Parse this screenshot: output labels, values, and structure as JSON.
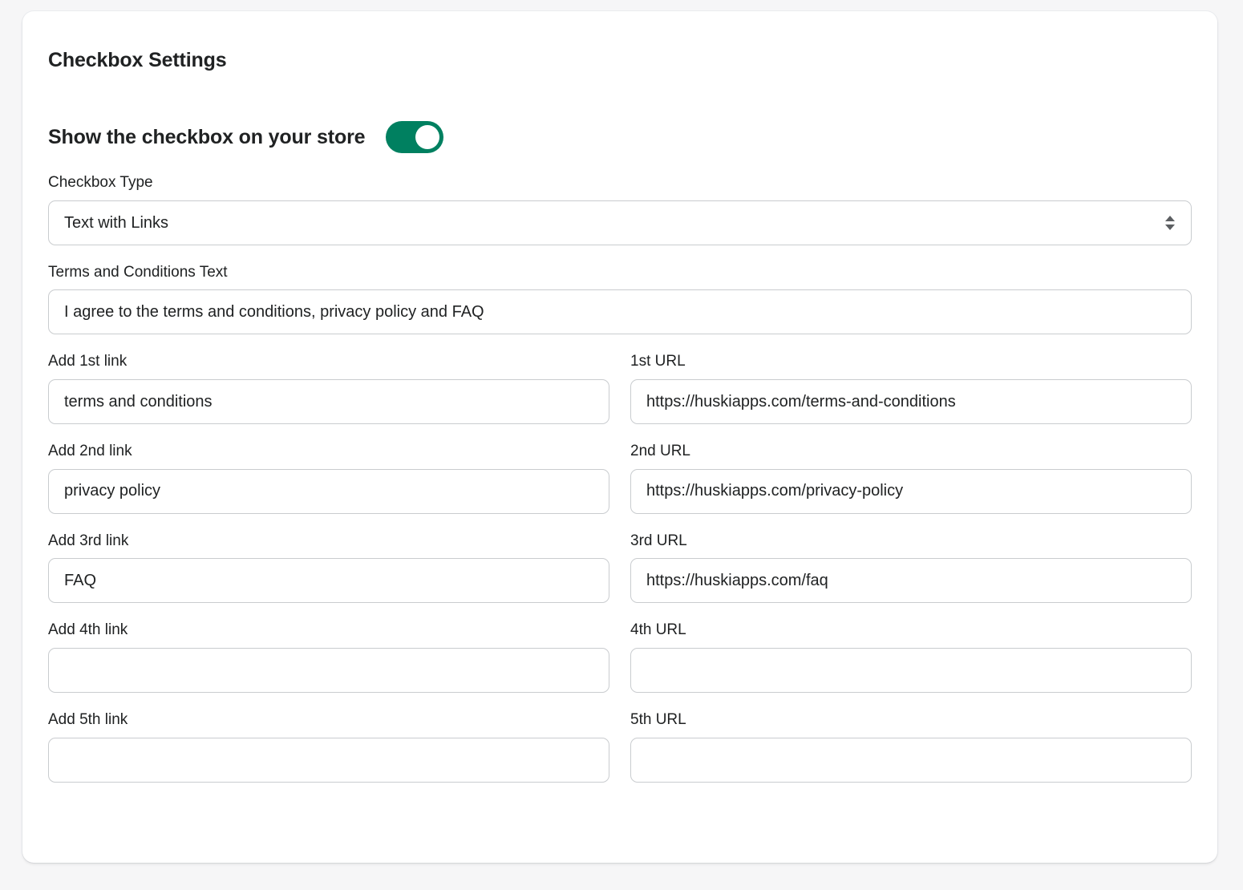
{
  "card": {
    "title": "Checkbox Settings"
  },
  "toggle": {
    "label": "Show the checkbox on your store",
    "state": "on",
    "color_on": "#008060",
    "knob_color": "#ffffff"
  },
  "checkbox_type": {
    "label": "Checkbox Type",
    "value": "Text with Links",
    "options": [
      "Text with Links"
    ],
    "icon": "chevron-updown-icon"
  },
  "terms_text": {
    "label": "Terms and Conditions Text",
    "value": "I agree to the terms and conditions, privacy policy and FAQ",
    "placeholder": ""
  },
  "links": [
    {
      "link_label": "Add 1st link",
      "link_value": "terms and conditions",
      "link_placeholder": "",
      "url_label": "1st URL",
      "url_value": "https://huskiapps.com/terms-and-conditions",
      "url_placeholder": ""
    },
    {
      "link_label": "Add 2nd link",
      "link_value": "privacy policy",
      "link_placeholder": "",
      "url_label": "2nd URL",
      "url_value": "https://huskiapps.com/privacy-policy",
      "url_placeholder": ""
    },
    {
      "link_label": "Add 3rd link",
      "link_value": "FAQ",
      "link_placeholder": "",
      "url_label": "3rd URL",
      "url_value": "https://huskiapps.com/faq",
      "url_placeholder": ""
    },
    {
      "link_label": "Add 4th link",
      "link_value": "",
      "link_placeholder": "",
      "url_label": "4th URL",
      "url_value": "",
      "url_placeholder": ""
    },
    {
      "link_label": "Add 5th link",
      "link_value": "",
      "link_placeholder": "",
      "url_label": "5th URL",
      "url_value": "",
      "url_placeholder": ""
    }
  ],
  "theme": {
    "page_background": "#f6f6f7",
    "card_background": "#ffffff",
    "text_primary": "#202223",
    "border": "#c9cccf",
    "accent": "#008060"
  }
}
